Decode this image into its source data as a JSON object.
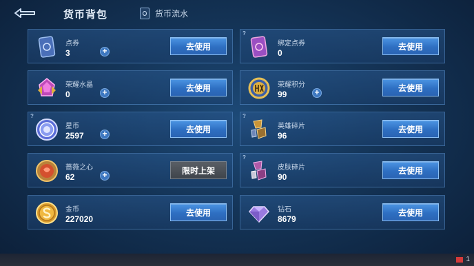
{
  "header": {
    "title": "货币背包",
    "flow_tab_label": "货币流水"
  },
  "actions": {
    "use_label": "去使用",
    "limited_label": "限时上架",
    "plus_symbol": "+"
  },
  "currencies": [
    {
      "name": "点券",
      "amount": "3",
      "icon": "ticket-card-icon",
      "color": "#5b7fc7"
    },
    {
      "name": "绑定点券",
      "amount": "0",
      "icon": "bound-ticket-card-icon",
      "color": "#b05bd0"
    },
    {
      "name": "荣耀水晶",
      "amount": "0",
      "icon": "honor-crystal-icon",
      "color": "#d050c0"
    },
    {
      "name": "荣耀积分",
      "amount": "99",
      "icon": "honor-points-icon",
      "color": "#e0b040"
    },
    {
      "name": "星币",
      "amount": "2597",
      "icon": "star-coin-icon",
      "color": "#6a7de0"
    },
    {
      "name": "英雄碎片",
      "amount": "96",
      "icon": "hero-shard-icon",
      "color": "#d4a03c"
    },
    {
      "name": "蔷薇之心",
      "amount": "62",
      "icon": "rose-heart-icon",
      "color": "#d66a3a"
    },
    {
      "name": "皮肤碎片",
      "amount": "90",
      "icon": "skin-shard-icon",
      "color": "#c26ab0"
    },
    {
      "name": "金币",
      "amount": "227020",
      "icon": "gold-coin-icon",
      "color": "#e0a830"
    },
    {
      "name": "钻石",
      "amount": "8679",
      "icon": "diamond-icon",
      "color": "#a98be8"
    }
  ],
  "footer": {
    "glyph": "1"
  }
}
